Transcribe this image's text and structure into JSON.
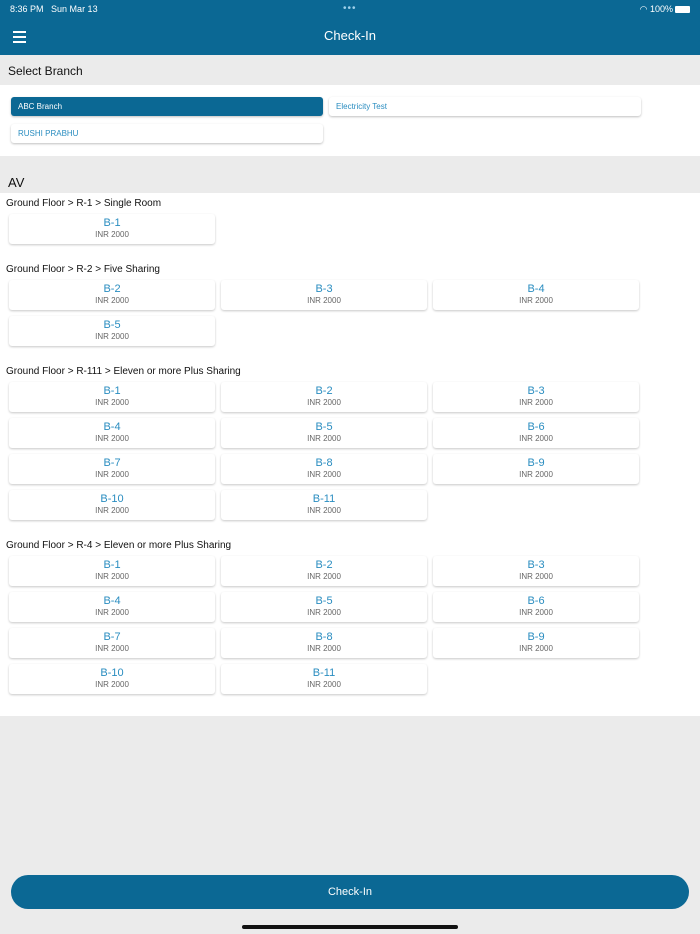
{
  "status": {
    "time": "8:36 PM",
    "date": "Sun Mar 13",
    "battery": "100%"
  },
  "header": {
    "title": "Check-In"
  },
  "branch": {
    "heading": "Select Branch",
    "items": [
      {
        "label": "ABC Branch",
        "selected": true
      },
      {
        "label": "Electricity Test",
        "selected": false
      },
      {
        "label": "RUSHI PRABHU",
        "selected": false
      }
    ]
  },
  "property": "AV",
  "rooms": [
    {
      "title": "Ground Floor > R-1 > Single Room",
      "beds": [
        {
          "name": "B-1",
          "price": "INR 2000"
        }
      ]
    },
    {
      "title": "Ground Floor > R-2 > Five Sharing",
      "beds": [
        {
          "name": "B-2",
          "price": "INR 2000"
        },
        {
          "name": "B-3",
          "price": "INR 2000"
        },
        {
          "name": "B-4",
          "price": "INR 2000"
        },
        {
          "name": "B-5",
          "price": "INR 2000"
        }
      ]
    },
    {
      "title": "Ground Floor > R-111 > Eleven or more Plus Sharing",
      "beds": [
        {
          "name": "B-1",
          "price": "INR 2000"
        },
        {
          "name": "B-2",
          "price": "INR 2000"
        },
        {
          "name": "B-3",
          "price": "INR 2000"
        },
        {
          "name": "B-4",
          "price": "INR 2000"
        },
        {
          "name": "B-5",
          "price": "INR 2000"
        },
        {
          "name": "B-6",
          "price": "INR 2000"
        },
        {
          "name": "B-7",
          "price": "INR 2000"
        },
        {
          "name": "B-8",
          "price": "INR 2000"
        },
        {
          "name": "B-9",
          "price": "INR 2000"
        },
        {
          "name": "B-10",
          "price": "INR 2000"
        },
        {
          "name": "B-11",
          "price": "INR 2000"
        }
      ]
    },
    {
      "title": "Ground Floor > R-4 > Eleven or more Plus Sharing",
      "beds": [
        {
          "name": "B-1",
          "price": "INR 2000"
        },
        {
          "name": "B-2",
          "price": "INR 2000"
        },
        {
          "name": "B-3",
          "price": "INR 2000"
        },
        {
          "name": "B-4",
          "price": "INR 2000"
        },
        {
          "name": "B-5",
          "price": "INR 2000"
        },
        {
          "name": "B-6",
          "price": "INR 2000"
        },
        {
          "name": "B-7",
          "price": "INR 2000"
        },
        {
          "name": "B-8",
          "price": "INR 2000"
        },
        {
          "name": "B-9",
          "price": "INR 2000"
        },
        {
          "name": "B-10",
          "price": "INR 2000"
        },
        {
          "name": "B-11",
          "price": "INR 2000"
        }
      ]
    }
  ],
  "checkin_button": "Check-In"
}
